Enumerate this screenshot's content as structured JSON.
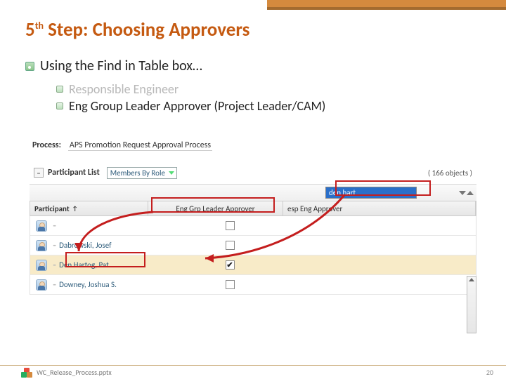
{
  "title": {
    "step_num": "5",
    "step_suffix": "th",
    "label": " Step: Choosing Approvers"
  },
  "bullets": {
    "main": "Using the Find in Table box…",
    "sub1": "Responsible Engineer",
    "sub2": "Eng Group Leader Approver (Project Leader/CAM)"
  },
  "process": {
    "label": "Process:",
    "value": "APS Promotion Request Approval Process"
  },
  "participant_list": {
    "title": "Participant List",
    "role_dd": "Members By Role",
    "count": "( 166 objects )",
    "collapse_symbol": "–"
  },
  "find": {
    "value": "den hart"
  },
  "headers": {
    "participant": "Participant",
    "sort_arrow": "↑",
    "col2": "Eng Grp Leader Approver",
    "col3": "esp Eng Approver"
  },
  "rows": [
    {
      "name": "",
      "checked": false
    },
    {
      "name": "Dabrowski, Josef",
      "checked": false
    },
    {
      "name": "Den Hartog, Pat",
      "checked": true
    },
    {
      "name": "Downey, Joshua S.",
      "checked": false
    }
  ],
  "footer": {
    "filename": "WC_Release_Process.pptx",
    "page": "20"
  }
}
